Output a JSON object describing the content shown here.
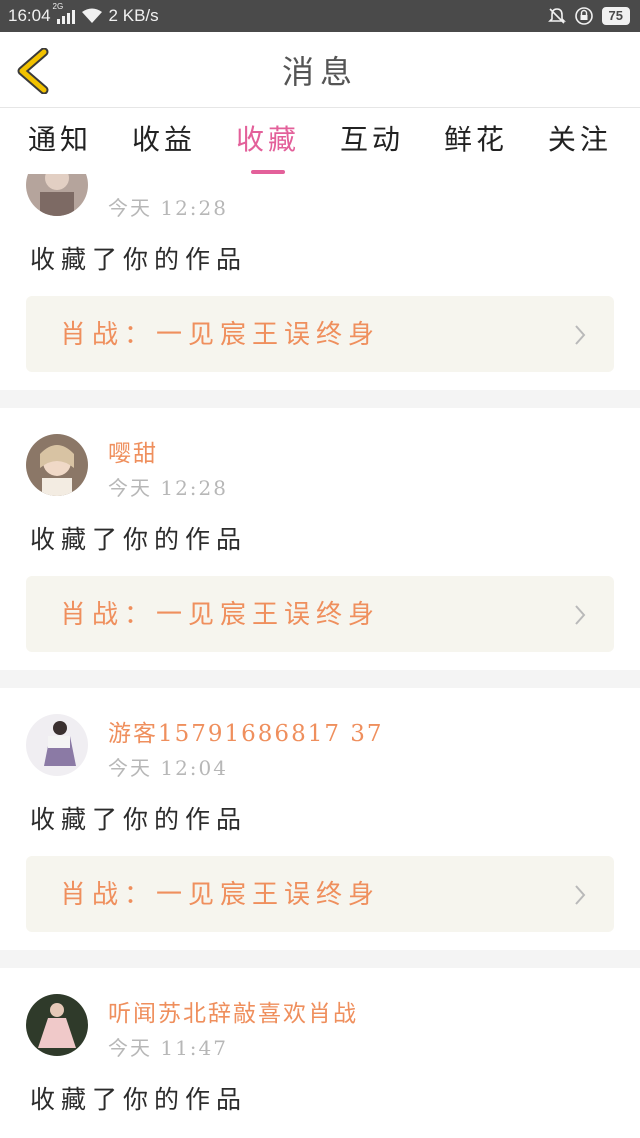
{
  "status_bar": {
    "time": "16:04",
    "network_tag": "2G",
    "speed": "2 KB/s",
    "battery": "75"
  },
  "header": {
    "title": "消息"
  },
  "tabs": [
    {
      "label": "通知",
      "active": false
    },
    {
      "label": "收益",
      "active": false
    },
    {
      "label": "收藏",
      "active": true
    },
    {
      "label": "互动",
      "active": false
    },
    {
      "label": "鲜花",
      "active": false
    },
    {
      "label": "关注",
      "active": false
    }
  ],
  "messages": [
    {
      "username": "",
      "time": "今天 12:28",
      "action": "收藏了你的作品",
      "work_title": "肖战：一见宸王误终身"
    },
    {
      "username": "嘤甜",
      "time": "今天 12:28",
      "action": "收藏了你的作品",
      "work_title": "肖战：一见宸王误终身"
    },
    {
      "username": "游客15791686817 37",
      "time": "今天 12:04",
      "action": "收藏了你的作品",
      "work_title": "肖战：一见宸王误终身"
    },
    {
      "username": "听闻苏北辞敲喜欢肖战",
      "time": "今天 11:47",
      "action": "收藏了你的作品",
      "work_title": ""
    }
  ],
  "colors": {
    "accent": "#e3609a",
    "username": "#ef8f5d",
    "work_box_bg": "#f6f5ee",
    "status_bar_bg": "#4a4a4a",
    "back_arrow": "#f2c200"
  }
}
